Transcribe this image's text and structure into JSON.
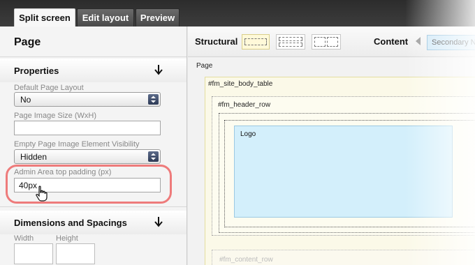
{
  "tabs": [
    {
      "label": "Split screen"
    },
    {
      "label": "Edit layout"
    },
    {
      "label": "Preview"
    }
  ],
  "left_panel": {
    "title": "Page",
    "properties": {
      "title": "Properties",
      "fields": [
        {
          "label": "Default Page Layout",
          "value": "No"
        },
        {
          "label": "Page Image Size (WxH)",
          "value": ""
        },
        {
          "label": "Empty Page Image Element Visibility",
          "value": "Hidden"
        },
        {
          "label": "Admin Area top padding (px)",
          "value": "40px"
        }
      ]
    },
    "dimensions": {
      "title": "Dimensions and Spacings",
      "width_label": "Width",
      "height_label": "Height"
    }
  },
  "toolbar": {
    "structural_label": "Structural",
    "content_label": "Content",
    "content_button": "Secondary N"
  },
  "canvas": {
    "page_label": "Page",
    "body_table": "#fm_site_body_table",
    "header_row": "#fm_header_row",
    "logo": "Logo",
    "content_row": "#fm_content_row"
  },
  "colors": {
    "highlight": "#ee7b7b",
    "logo_fill": "#d3effb",
    "body_fill": "#fbf9e8"
  }
}
